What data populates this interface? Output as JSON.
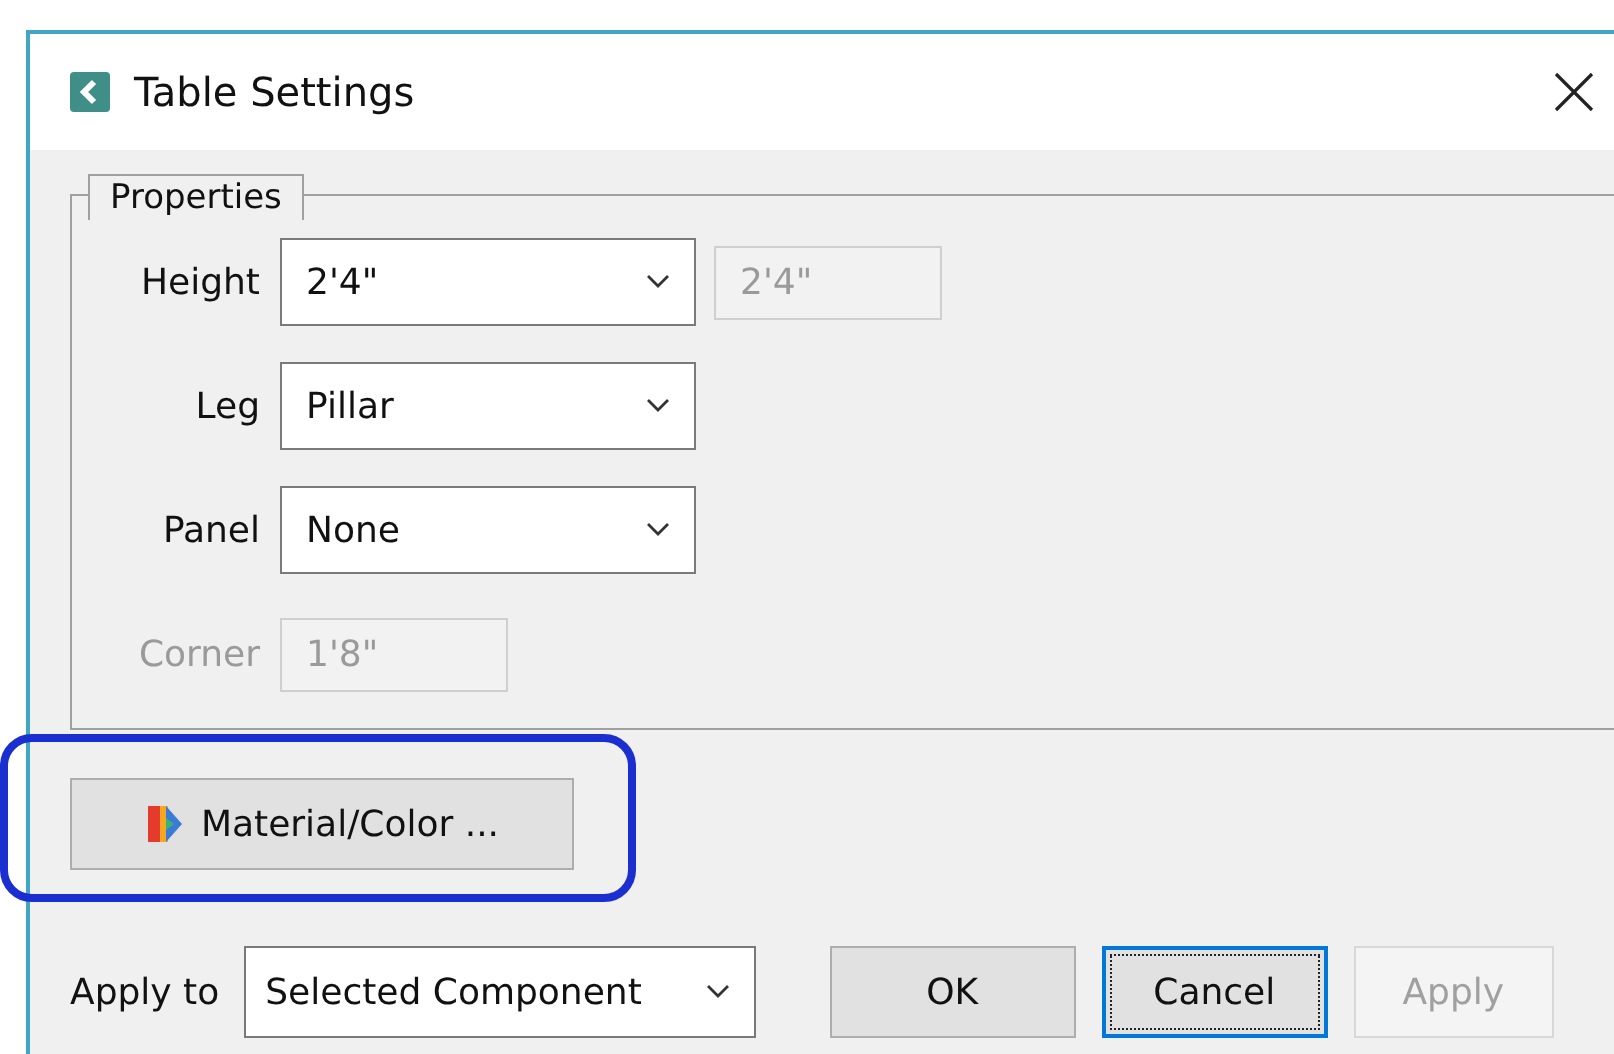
{
  "window": {
    "title": "Table Settings"
  },
  "properties": {
    "title": "Properties",
    "rows": [
      {
        "kind": "combo",
        "label": "Height",
        "value": "2'4\"",
        "disabled": false,
        "readout": "2'4\""
      },
      {
        "kind": "combo",
        "label": "Leg",
        "value": "Pillar",
        "disabled": false
      },
      {
        "kind": "combo",
        "label": "Panel",
        "value": "None",
        "disabled": false
      },
      {
        "kind": "field",
        "label": "Corner",
        "value": "1'8\"",
        "disabled": true
      }
    ]
  },
  "material_button": {
    "label": "Material/Color ...",
    "highlighted": true
  },
  "apply_to": {
    "label": "Apply to",
    "value": "Selected Component"
  },
  "buttons": [
    {
      "label": "OK",
      "focused": false,
      "disabled": false
    },
    {
      "label": "Cancel",
      "focused": true,
      "disabled": false
    },
    {
      "label": "Apply",
      "focused": false,
      "disabled": true
    }
  ]
}
